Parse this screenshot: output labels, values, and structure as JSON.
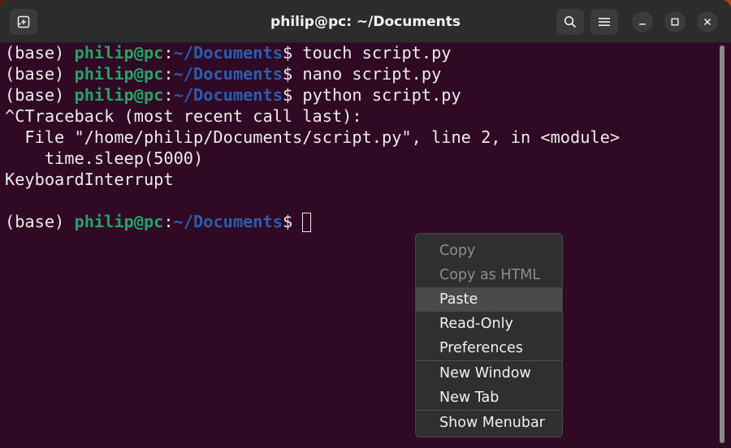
{
  "window": {
    "title": "philip@pc: ~/Documents"
  },
  "prompt": {
    "env": "(base) ",
    "user": "philip@pc",
    "colon": ":",
    "path": "~/Documents",
    "dollar": "$ "
  },
  "lines": [
    {
      "type": "cmd",
      "command": "touch script.py"
    },
    {
      "type": "cmd",
      "command": "nano script.py"
    },
    {
      "type": "cmd",
      "command": "python script.py"
    },
    {
      "type": "out",
      "text": "^CTraceback (most recent call last):"
    },
    {
      "type": "out",
      "text": "  File \"/home/philip/Documents/script.py\", line 2, in <module>"
    },
    {
      "type": "out",
      "text": "    time.sleep(5000)"
    },
    {
      "type": "out",
      "text": "KeyboardInterrupt"
    },
    {
      "type": "out",
      "text": ""
    },
    {
      "type": "cmd",
      "command": ""
    }
  ],
  "context_menu": {
    "items": [
      {
        "label": "Copy",
        "enabled": false
      },
      {
        "label": "Copy as HTML",
        "enabled": false
      },
      {
        "label": "Paste",
        "enabled": true,
        "hovered": true
      },
      {
        "label": "Read-Only",
        "enabled": true
      },
      {
        "label": "Preferences",
        "enabled": true
      },
      {
        "label": "New Window",
        "enabled": true
      },
      {
        "label": "New Tab",
        "enabled": true
      },
      {
        "label": "Show Menubar",
        "enabled": true
      }
    ]
  },
  "icons": {
    "new_tab": "new-tab-icon",
    "search": "search-icon",
    "menu": "hamburger-menu-icon",
    "minimize": "minimize-icon",
    "maximize": "maximize-icon",
    "close": "close-icon"
  },
  "colors": {
    "terminal_bg": "#300a24",
    "user": "#26a269",
    "path": "#2a5db0"
  }
}
